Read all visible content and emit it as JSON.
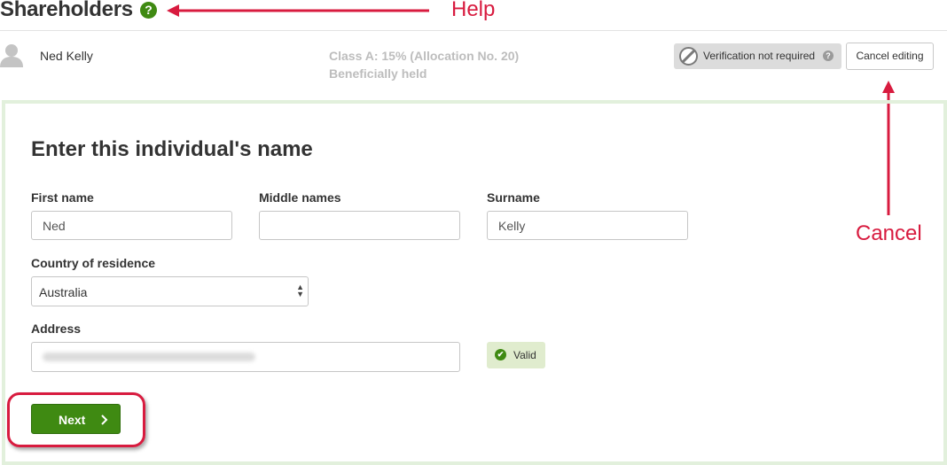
{
  "header": {
    "title": "Shareholders",
    "help_icon_glyph": "?",
    "help_icon": "question-circle-icon"
  },
  "annotations": {
    "help_label": "Help",
    "cancel_label": "Cancel",
    "color": "#d81b3f"
  },
  "shareholder": {
    "avatar_icon": "user-silhouette-icon",
    "name": "Ned Kelly",
    "class_info": "Class A: 15% (Allocation No. 20)",
    "holding": "Beneficially held",
    "verification_label": "Verification not required",
    "verification_icon": "prohibited-circle-icon",
    "verification_help_glyph": "?",
    "cancel_button_label": "Cancel editing"
  },
  "form": {
    "heading": "Enter this individual's name",
    "first_name": {
      "label": "First name",
      "value": "Ned"
    },
    "middle_names": {
      "label": "Middle names",
      "value": ""
    },
    "surname": {
      "label": "Surname",
      "value": "Kelly"
    },
    "country": {
      "label": "Country of residence",
      "selected": "Australia"
    },
    "address": {
      "label": "Address",
      "value_obscured": true
    },
    "valid_badge": {
      "label": "Valid",
      "icon": "check-circle-icon",
      "icon_glyph": "✔"
    },
    "next_button": {
      "label": "Next",
      "icon": "chevron-right-icon"
    }
  },
  "colors": {
    "brand_green": "#3f8a12",
    "panel_border": "#e2f0dc",
    "valid_bg": "#e0ecce",
    "muted_text": "#bdbdbd"
  }
}
